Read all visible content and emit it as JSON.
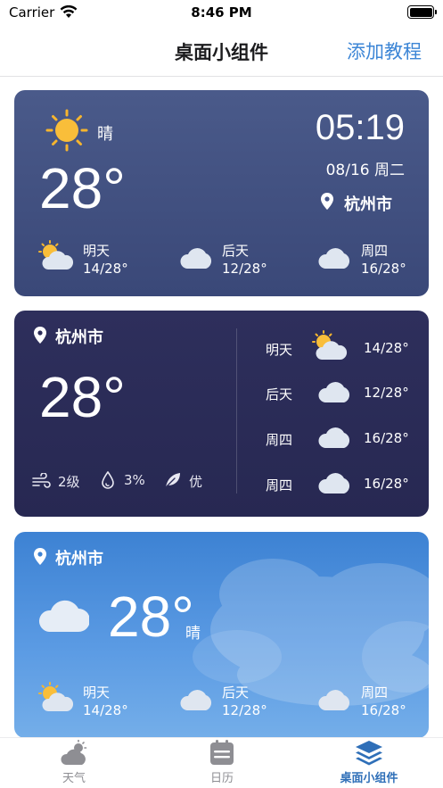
{
  "status_bar": {
    "carrier": "Carrier",
    "time": "8:46 PM"
  },
  "nav": {
    "title": "桌面小组件",
    "action": "添加教程"
  },
  "widget_small_blue": {
    "condition": "晴",
    "temperature": "28°",
    "time": "05:19",
    "date": "08/16 周二",
    "city": "杭州市",
    "forecast": [
      {
        "day": "明天",
        "range": "14/28°",
        "icon": "partly-cloudy-icon"
      },
      {
        "day": "后天",
        "range": "12/28°",
        "icon": "cloud-icon"
      },
      {
        "day": "周四",
        "range": "16/28°",
        "icon": "cloud-icon"
      }
    ]
  },
  "widget_dark": {
    "city": "杭州市",
    "temperature": "28°",
    "wind": "2级",
    "humidity": "3%",
    "air_quality": "优",
    "forecast": [
      {
        "day": "明天",
        "range": "14/28°",
        "icon": "partly-cloudy-icon"
      },
      {
        "day": "后天",
        "range": "12/28°",
        "icon": "cloud-icon"
      },
      {
        "day": "周四",
        "range": "16/28°",
        "icon": "cloud-icon"
      },
      {
        "day": "周四",
        "range": "16/28°",
        "icon": "cloud-icon"
      }
    ]
  },
  "widget_sky": {
    "city": "杭州市",
    "temperature": "28°",
    "condition": "晴",
    "forecast": [
      {
        "day": "明天",
        "range": "14/28°",
        "icon": "partly-cloudy-icon"
      },
      {
        "day": "后天",
        "range": "12/28°",
        "icon": "cloud-icon"
      },
      {
        "day": "周四",
        "range": "16/28°",
        "icon": "cloud-icon"
      }
    ]
  },
  "tabs": [
    {
      "label": "天气",
      "icon": "weather-icon",
      "active": false
    },
    {
      "label": "日历",
      "icon": "calendar-icon",
      "active": false
    },
    {
      "label": "桌面小组件",
      "icon": "layers-icon",
      "active": true
    }
  ],
  "colors": {
    "accent": "#3d86d6",
    "tab_active": "#2f6fb8",
    "card1": "#45558a",
    "card2": "#2b2c58",
    "card3": "#4d92dc"
  }
}
